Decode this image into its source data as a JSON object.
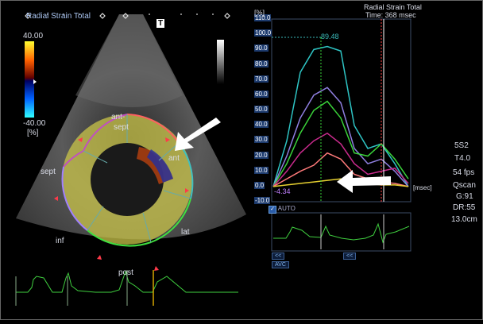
{
  "echo": {
    "title": "Radial Strain Total",
    "t_button": "T",
    "colorbar": {
      "max": "40.00",
      "min": "-40.00",
      "unit": "[%]"
    },
    "segments": {
      "ant_sept": "ant-",
      "ant_sept2": "sept",
      "ant": "ant",
      "sept": "sept",
      "lat": "lat",
      "inf": "inf",
      "post": "post"
    }
  },
  "graph": {
    "title": "Radial Strain Total",
    "time_label": "Time: 368 msec",
    "y_unit": "[%]",
    "y_ticks": [
      "110.0",
      "100.0",
      "90.0",
      "80.0",
      "70.0",
      "60.0",
      "50.0",
      "40.0",
      "30.0",
      "20.0",
      "10.0",
      "0.0",
      "-10.0"
    ],
    "x_unit": "[msec]",
    "peak_label": "89.48",
    "min_label": "-4.34",
    "auto_label": "AUTO",
    "avc_label": "AVC",
    "nav_prev": "<<",
    "nav_next": "<<"
  },
  "params": [
    "5S2",
    "T4.0",
    "54 fps",
    "Qscan",
    "G:91",
    "DR:55",
    "13.0cm"
  ],
  "chart_data": {
    "type": "line",
    "title": "Radial Strain Total",
    "ylabel": "[%]",
    "xlabel": "[msec]",
    "ylim": [
      -10,
      110
    ],
    "x": [
      0,
      20,
      40,
      60,
      80,
      100,
      120,
      140,
      160,
      180,
      200
    ],
    "series": [
      {
        "color": "#2ec4c4",
        "values": [
          0,
          30,
          75,
          90,
          92,
          89,
          40,
          25,
          28,
          15,
          0
        ]
      },
      {
        "color": "#8f7fe0",
        "values": [
          0,
          20,
          45,
          60,
          65,
          55,
          25,
          15,
          18,
          10,
          0
        ]
      },
      {
        "color": "#3ad43a",
        "values": [
          0,
          15,
          35,
          50,
          56,
          45,
          22,
          20,
          28,
          18,
          5
        ]
      },
      {
        "color": "#c82a8c",
        "values": [
          0,
          10,
          22,
          30,
          35,
          28,
          15,
          8,
          10,
          12,
          2
        ]
      },
      {
        "color": "#ff7a7a",
        "values": [
          0,
          5,
          10,
          14,
          22,
          18,
          8,
          5,
          3,
          2,
          0
        ]
      },
      {
        "color": "#e6d030",
        "values": [
          0,
          1,
          2,
          3,
          4,
          5,
          3,
          2,
          1,
          1,
          0
        ]
      }
    ]
  }
}
